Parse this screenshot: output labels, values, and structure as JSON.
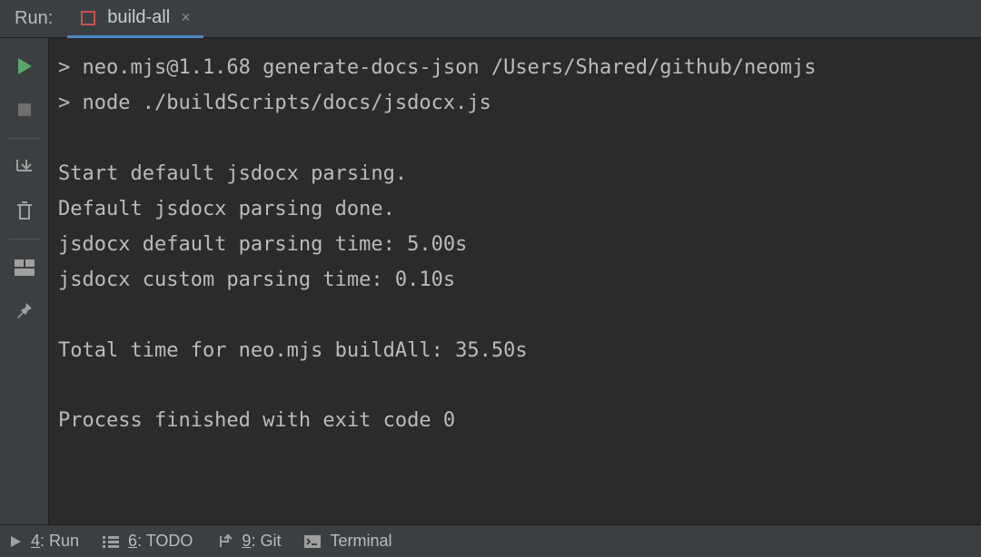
{
  "header": {
    "label": "Run:",
    "tab": {
      "name": "build-all"
    }
  },
  "console": {
    "lines": [
      "> neo.mjs@1.1.68 generate-docs-json /Users/Shared/github/neomjs",
      "> node ./buildScripts/docs/jsdocx.js",
      "",
      "Start default jsdocx parsing.",
      "Default jsdocx parsing done.",
      "jsdocx default parsing time: 5.00s",
      "jsdocx custom parsing time: 0.10s",
      "",
      "Total time for neo.mjs buildAll: 35.50s",
      "",
      "Process finished with exit code 0"
    ]
  },
  "footer": {
    "run": {
      "num": "4",
      "label": ": Run"
    },
    "todo": {
      "num": "6",
      "label": ": TODO"
    },
    "git": {
      "num": "9",
      "label": ": Git"
    },
    "terminal": {
      "label": "Terminal"
    }
  }
}
